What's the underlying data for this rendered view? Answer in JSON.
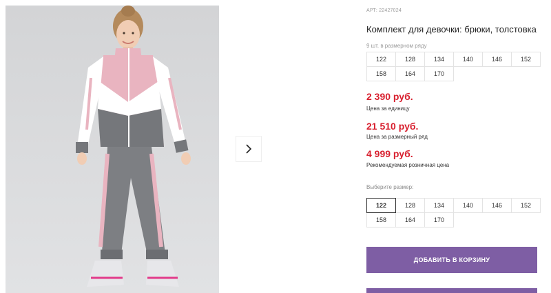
{
  "gallery": {
    "photo_alt": "Комплект для девочки: брюки, толстовка",
    "next_icon": "chevron-right-icon"
  },
  "product": {
    "sku": "АРТ: 22427024",
    "title": "Комплект для девочки: брюки, толстовка",
    "pack_note": "9 шт. в размерном ряду",
    "pack_sizes": [
      "122",
      "128",
      "134",
      "140",
      "146",
      "152",
      "158",
      "164",
      "170"
    ],
    "prices": [
      {
        "value": "2 390 руб.",
        "label": "Цена за единицу"
      },
      {
        "value": "21 510 руб.",
        "label": "Цена за размерный ряд"
      },
      {
        "value": "4 999 руб.",
        "label": "Рекомендуемая розничная цена"
      }
    ],
    "choose_size_label": "Выберите размер:",
    "size_options": [
      "122",
      "128",
      "134",
      "140",
      "146",
      "152",
      "158",
      "164",
      "170"
    ],
    "selected_size": "122",
    "add_to_cart_label": "ДОБАВИТЬ В КОРЗИНУ"
  },
  "colors": {
    "price_red": "#d8202f",
    "button_purple": "#7e5ea4",
    "jacket_pink": "#e9b4c0",
    "jacket_gray": "#75777b"
  }
}
